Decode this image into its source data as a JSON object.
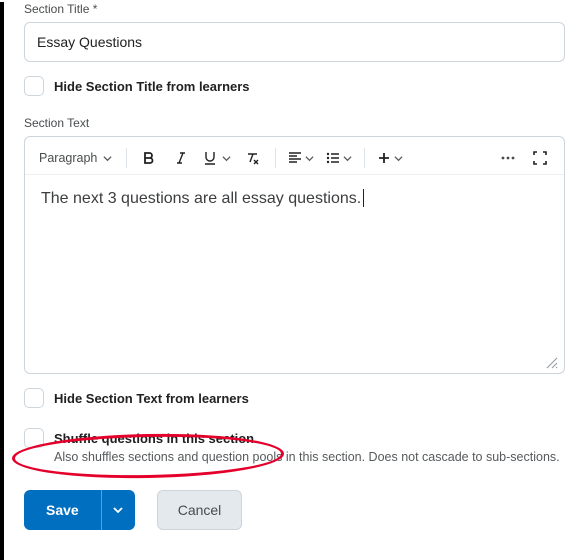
{
  "section_title": {
    "label": "Section Title",
    "required_marker": "*",
    "value": "Essay Questions"
  },
  "hide_title": {
    "label": "Hide Section Title from learners",
    "checked": false
  },
  "section_text": {
    "label": "Section Text",
    "body": "The next 3 questions are all essay questions."
  },
  "toolbar": {
    "paragraph_label": "Paragraph"
  },
  "hide_text": {
    "label": "Hide Section Text from learners",
    "checked": false
  },
  "shuffle": {
    "label": "Shuffle questions in this section",
    "help": "Also shuffles sections and question pools in this section. Does not cascade to sub-sections.",
    "checked": false
  },
  "buttons": {
    "save": "Save",
    "cancel": "Cancel"
  }
}
